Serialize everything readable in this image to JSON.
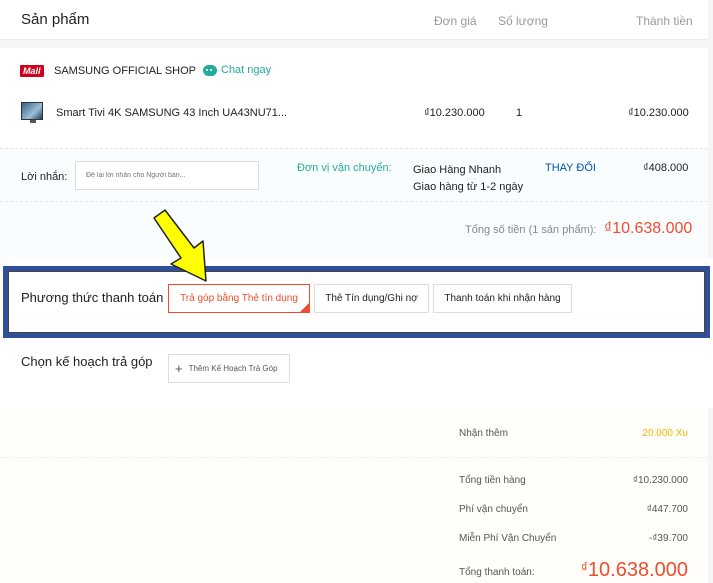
{
  "header": {
    "title": "Sản phẩm",
    "col_price": "Đơn giá",
    "col_qty": "Số lượng",
    "col_total": "Thành tiền"
  },
  "shop": {
    "badge": "Mall",
    "name": "SAMSUNG OFFICIAL SHOP",
    "chat": "Chat ngay"
  },
  "product": {
    "name": "Smart Tivi 4K SAMSUNG 43 Inch UA43NU71...",
    "price": "₫10.230.000",
    "qty": "1",
    "total": "₫10.230.000"
  },
  "message": {
    "label": "Lời nhắn:",
    "placeholder": "Để lại lời nhắn cho Người bán..."
  },
  "shipping": {
    "label": "Đơn vị vận chuyển:",
    "carrier": "Giao Hàng Nhanh",
    "eta": "Giao hàng từ 1-2 ngày",
    "change": "THAY ĐỔI",
    "fee": "₫408.000"
  },
  "summary": {
    "label": "Tổng số tiền (1 sản phẩm):",
    "value": "₫10.638.000"
  },
  "payment": {
    "label": "Phương thức thanh toán",
    "options": [
      "Trả góp bằng Thẻ tín dụng",
      "Thẻ Tín dụng/Ghi nợ",
      "Thanh toán khi nhận hàng"
    ]
  },
  "installment": {
    "label": "Chọn kế hoạch trả góp",
    "add": "Thêm Kế Hoạch Trả Góp"
  },
  "footer": {
    "bonus_label": "Nhận thêm",
    "bonus_value": "20.000 Xu",
    "rows": [
      {
        "label": "Tổng tiền hàng",
        "value": "₫10.230.000"
      },
      {
        "label": "Phí vận chuyển",
        "value": "₫447.700"
      },
      {
        "label": "Miễn Phí Vận Chuyển",
        "value": "-₫39.700"
      }
    ],
    "grand_label": "Tổng thanh toán:",
    "grand_currency": "₫",
    "grand_value": "10.638.000"
  },
  "colors": {
    "accent": "#ee4d2d",
    "teal": "#26aa99",
    "frame": "#2f4f9a",
    "arrow": "#ffff00"
  }
}
